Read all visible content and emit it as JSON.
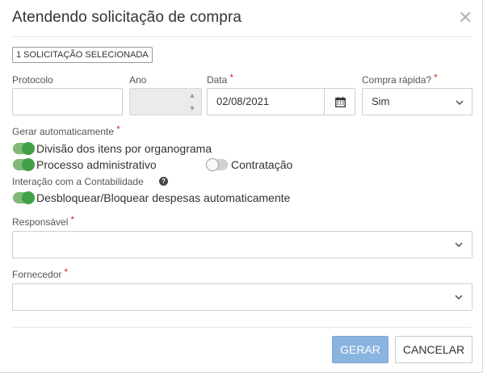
{
  "dialog": {
    "title": "Atendendo solicitação de compra",
    "close_icon": "close-icon",
    "selected_badge": "1 SOLICITAÇÃO SELECIONADA"
  },
  "fields": {
    "protocolo": {
      "label": "Protocolo",
      "value": "",
      "required": false
    },
    "ano": {
      "label": "Ano",
      "value": "",
      "required": false,
      "disabled": true
    },
    "data": {
      "label": "Data",
      "value": "02/08/2021",
      "required": true,
      "icon": "calendar-icon"
    },
    "compra_rapida": {
      "label": "Compra rápida?",
      "value": "Sim",
      "required": true
    }
  },
  "required_marker": "*",
  "gerar": {
    "label": "Gerar automaticamente",
    "required": true,
    "toggles": [
      {
        "label": "Divisão dos itens por organograma",
        "on": true
      },
      {
        "label": "Processo administrativo",
        "on": true
      },
      {
        "label": "Contratação",
        "on": false
      }
    ]
  },
  "contabilidade": {
    "label": "Interação com a Contabilidade",
    "help_icon": "question-circle-icon",
    "toggles": [
      {
        "label": "Desbloquear/Bloquear despesas automaticamente",
        "on": true
      }
    ]
  },
  "responsavel": {
    "label": "Responsável",
    "value": "",
    "required": true
  },
  "fornecedor": {
    "label": "Fornecedor",
    "value": "",
    "required": true
  },
  "actions": {
    "primary": "GERAR",
    "secondary": "CANCELAR"
  },
  "colors": {
    "toggle_on": "#43a047",
    "primary_button": "#8ab4e0",
    "required": "#d9302b"
  }
}
